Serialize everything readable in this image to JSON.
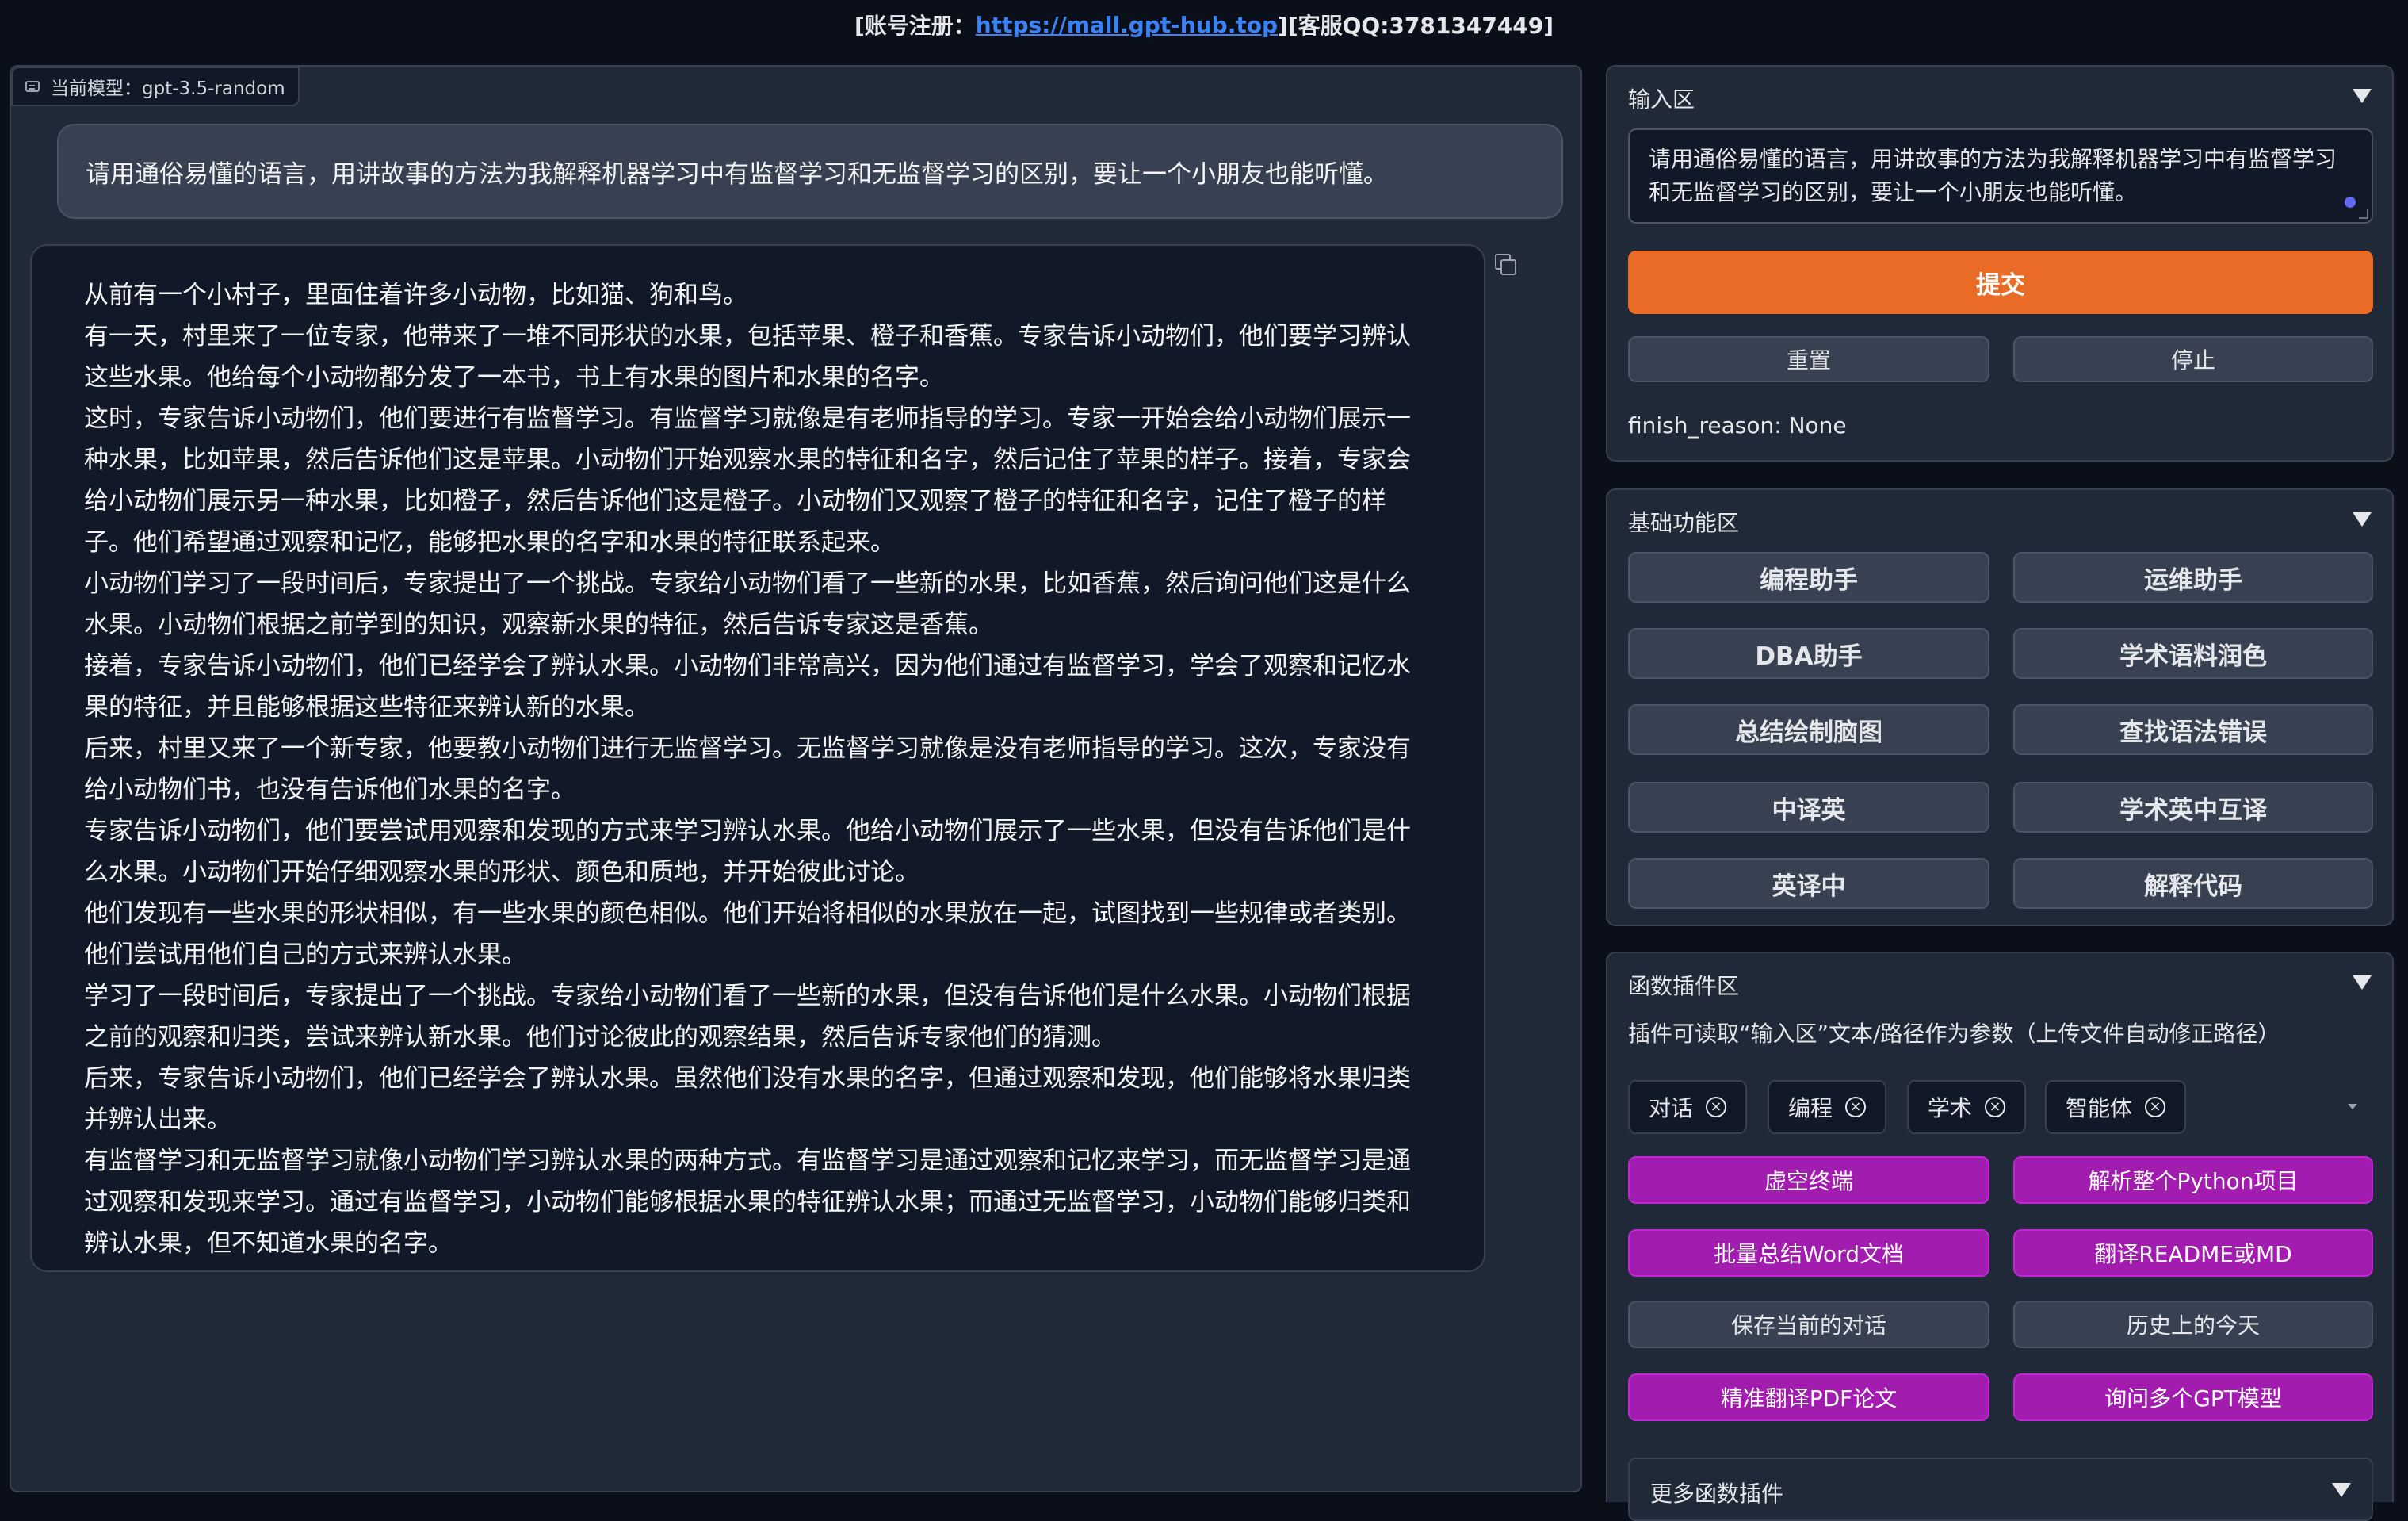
{
  "header": {
    "prefix": "[账号注册：",
    "link": "https://mall.gpt-hub.top",
    "suffix": "][客服QQ:3781347449]"
  },
  "chat": {
    "model_label": "当前模型：gpt-3.5-random",
    "user_message": "请用通俗易懂的语言，用讲故事的方法为我解释机器学习中有监督学习和无监督学习的区别，要让一个小朋友也能听懂。",
    "bot_lines": [
      "从前有一个小村子，里面住着许多小动物，比如猫、狗和鸟。",
      "有一天，村里来了一位专家，他带来了一堆不同形状的水果，包括苹果、橙子和香蕉。专家告诉小动物们，他们要学习辨认",
      "这些水果。他给每个小动物都分发了一本书，书上有水果的图片和水果的名字。",
      "这时，专家告诉小动物们，他们要进行有监督学习。有监督学习就像是有老师指导的学习。专家一开始会给小动物们展示一",
      "种水果，比如苹果，然后告诉他们这是苹果。小动物们开始观察水果的特征和名字，然后记住了苹果的样子。接着，专家会",
      "给小动物们展示另一种水果，比如橙子，然后告诉他们这是橙子。小动物们又观察了橙子的特征和名字，记住了橙子的样",
      "子。他们希望通过观察和记忆，能够把水果的名字和水果的特征联系起来。",
      "小动物们学习了一段时间后，专家提出了一个挑战。专家给小动物们看了一些新的水果，比如香蕉，然后询问他们这是什么",
      "水果。小动物们根据之前学到的知识，观察新水果的特征，然后告诉专家这是香蕉。",
      "接着，专家告诉小动物们，他们已经学会了辨认水果。小动物们非常高兴，因为他们通过有监督学习，学会了观察和记忆水",
      "果的特征，并且能够根据这些特征来辨认新的水果。",
      "后来，村里又来了一个新专家，他要教小动物们进行无监督学习。无监督学习就像是没有老师指导的学习。这次，专家没有",
      "给小动物们书，也没有告诉他们水果的名字。",
      "专家告诉小动物们，他们要尝试用观察和发现的方式来学习辨认水果。他给小动物们展示了一些水果，但没有告诉他们是什",
      "么水果。小动物们开始仔细观察水果的形状、颜色和质地，并开始彼此讨论。",
      "他们发现有一些水果的形状相似，有一些水果的颜色相似。他们开始将相似的水果放在一起，试图找到一些规律或者类别。",
      "他们尝试用他们自己的方式来辨认水果。",
      "学习了一段时间后，专家提出了一个挑战。专家给小动物们看了一些新的水果，但没有告诉他们是什么水果。小动物们根据",
      "之前的观察和归类，尝试来辨认新水果。他们讨论彼此的观察结果，然后告诉专家他们的猜测。",
      "后来，专家告诉小动物们，他们已经学会了辨认水果。虽然他们没有水果的名字，但通过观察和发现，他们能够将水果归类",
      "并辨认出来。",
      "有监督学习和无监督学习就像小动物们学习辨认水果的两种方式。有监督学习是通过观察和记忆来学习，而无监督学习是通",
      "过观察和发现来学习。通过有监督学习，小动物们能够根据水果的特征辨认水果；而通过无监督学习，小动物们能够归类和",
      "辨认水果，但不知道水果的名字。"
    ]
  },
  "input_panel": {
    "title": "输入区",
    "text": "请用通俗易懂的语言，用讲故事的方法为我解释机器学习中有监督学习和无监督学习的区别，要让一个小朋友也能听懂。",
    "submit": "提交",
    "reset": "重置",
    "stop": "停止",
    "finish_reason": "finish_reason: None"
  },
  "basic_panel": {
    "title": "基础功能区",
    "buttons": [
      "编程助手",
      "运维助手",
      "DBA助手",
      "学术语料润色",
      "总结绘制脑图",
      "查找语法错误",
      "中译英",
      "学术英中互译",
      "英译中",
      "解释代码"
    ]
  },
  "plugin_panel": {
    "title": "函数插件区",
    "hint": "插件可读取“输入区”文本/路径作为参数（上传文件自动修正路径）",
    "tags": [
      "对话",
      "编程",
      "学术",
      "智能体"
    ],
    "buttons": [
      "虚空终端",
      "解析整个Python项目",
      "批量总结Word文档",
      "翻译README或MD",
      "保存当前的对话",
      "历史上的今天",
      "精准翻译PDF论文",
      "询问多个GPT模型"
    ],
    "more": "更多函数插件"
  },
  "colors": {
    "background": "#0b0f19",
    "accent_orange": "#ea6b25",
    "plugin_purple": "#a21caf",
    "link": "#3b82f6"
  }
}
